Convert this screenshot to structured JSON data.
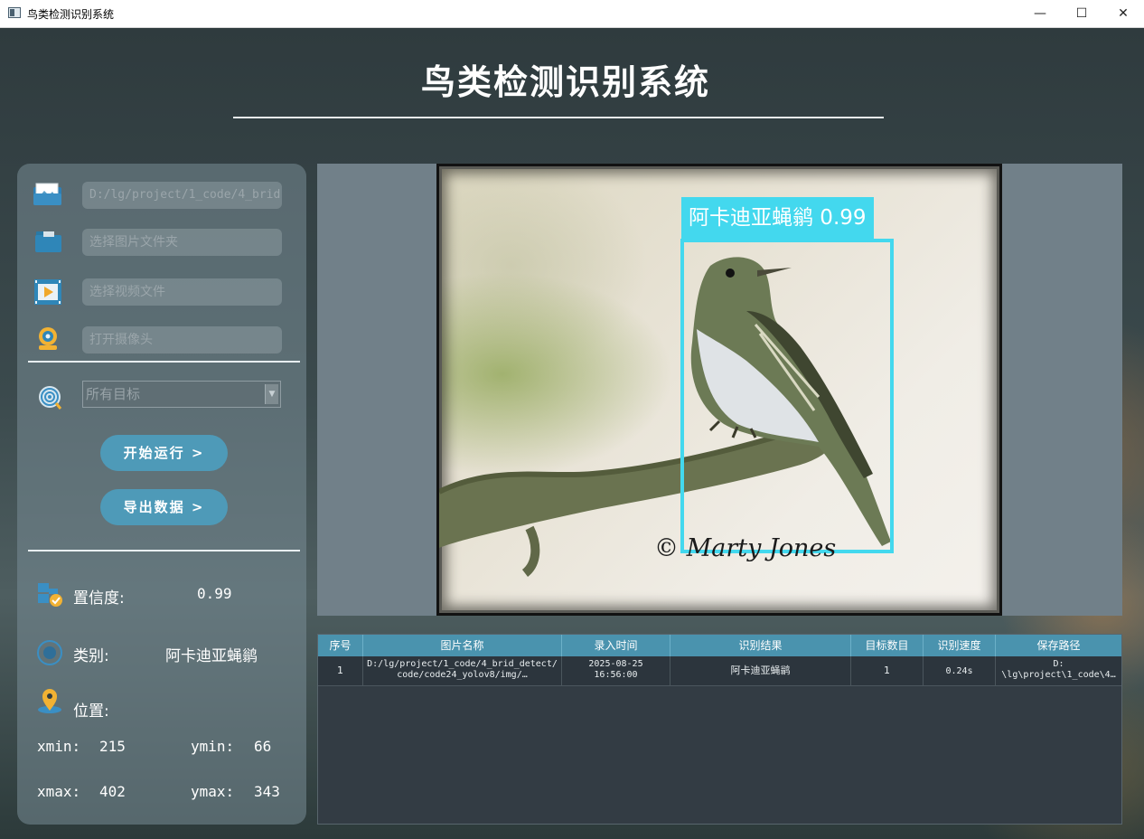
{
  "window": {
    "title": "鸟类检测识别系统",
    "minimize": "—",
    "maximize": "☐",
    "close": "✕"
  },
  "header": {
    "title": "鸟类检测识别系统"
  },
  "inputs": {
    "image_path": "D:/lg/project/1_code/4_brid",
    "folder_placeholder": "选择图片文件夹",
    "video_placeholder": "选择视频文件",
    "camera_placeholder": "打开摄像头"
  },
  "target_select": {
    "selected": "所有目标"
  },
  "buttons": {
    "run": "开始运行 >",
    "export": "导出数据 >"
  },
  "stats": {
    "confidence_label": "置信度:",
    "confidence_value": "0.99",
    "class_label": "类别:",
    "class_value": "阿卡迪亚蝇鹟",
    "position_label": "位置:",
    "xmin_label": "xmin:",
    "xmin_value": "215",
    "ymin_label": "ymin:",
    "ymin_value": "66",
    "xmax_label": "xmax:",
    "xmax_value": "402",
    "ymax_label": "ymax:",
    "ymax_value": "343"
  },
  "detection": {
    "label": "阿卡迪亚蝇鹟 0.99",
    "watermark": "© Marty Jones"
  },
  "table": {
    "headers": [
      "序号",
      "图片名称",
      "录入时间",
      "识别结果",
      "目标数目",
      "识别速度",
      "保存路径"
    ],
    "rows": [
      {
        "index": "1",
        "name_line1": "D:/lg/project/1_code/4_brid_detect/",
        "name_line2": "code/code24_yolov8/img/…",
        "date": "2025-08-25",
        "time": "16:56:00",
        "result": "阿卡迪亚蝇鹟",
        "count": "1",
        "speed": "0.24s",
        "path_line1": "D:",
        "path_line2": "\\lg\\project\\1_code\\4…"
      }
    ]
  },
  "colors": {
    "accent": "#4e9ab8",
    "detection": "#43d8ee",
    "table_header": "#4a93ae"
  }
}
